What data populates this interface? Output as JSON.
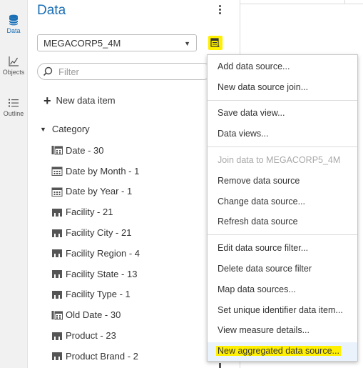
{
  "rail": {
    "items": [
      {
        "label": "Data",
        "icon": "database-icon",
        "active": true
      },
      {
        "label": "Objects",
        "icon": "line-chart-icon",
        "active": false
      },
      {
        "label": "Outline",
        "icon": "outline-list-icon",
        "active": false
      }
    ]
  },
  "panel": {
    "title": "Data",
    "data_source_value": "MEGACORP5_4M",
    "filter_placeholder": "Filter",
    "new_item_label": "New data item",
    "category_label": "Category",
    "items": [
      {
        "label": "Date - 30",
        "icon": "date-hierarchy-icon"
      },
      {
        "label": "Date by Month - 1",
        "icon": "calendar-icon"
      },
      {
        "label": "Date by Year - 1",
        "icon": "calendar-icon"
      },
      {
        "label": "Facility - 21",
        "icon": "category-icon"
      },
      {
        "label": "Facility City - 21",
        "icon": "category-icon"
      },
      {
        "label": "Facility Region - 4",
        "icon": "category-icon"
      },
      {
        "label": "Facility State - 13",
        "icon": "category-icon"
      },
      {
        "label": "Facility Type - 1",
        "icon": "category-icon"
      },
      {
        "label": "Old Date - 30",
        "icon": "date-hierarchy-icon"
      },
      {
        "label": "Product - 23",
        "icon": "category-icon"
      },
      {
        "label": "Product Brand - 2",
        "icon": "category-icon"
      }
    ]
  },
  "menu": {
    "items": [
      {
        "label": "Add data source...",
        "disabled": false
      },
      {
        "label": "New data source join...",
        "disabled": false
      },
      {
        "label": "Save data view...",
        "disabled": false
      },
      {
        "label": "Data views...",
        "disabled": false
      },
      {
        "label": "Join data to MEGACORP5_4M",
        "disabled": true
      },
      {
        "label": "Remove data source",
        "disabled": false
      },
      {
        "label": "Change data source...",
        "disabled": false
      },
      {
        "label": "Refresh data source",
        "disabled": false
      },
      {
        "label": "Edit data source filter...",
        "disabled": false
      },
      {
        "label": "Delete data source filter",
        "disabled": false
      },
      {
        "label": "Map data sources...",
        "disabled": false
      },
      {
        "label": "Set unique identifier data item...",
        "disabled": false
      },
      {
        "label": "View measure details...",
        "disabled": false
      },
      {
        "label": "New aggregated data source...",
        "disabled": false,
        "highlighted": true
      }
    ]
  },
  "colors": {
    "accent": "#1a6fb5",
    "highlight": "#ffef00",
    "rail_bg": "#f1f1f1"
  }
}
